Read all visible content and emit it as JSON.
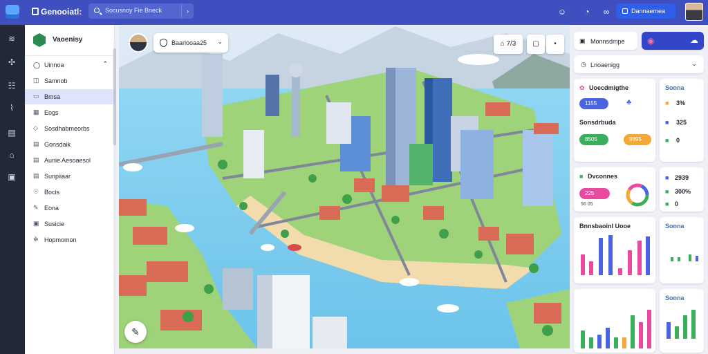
{
  "topbar": {
    "title": "Genooiatl:",
    "search_placeholder": "Socusnoy Fie Bneck",
    "user_button": "Dannaemea",
    "icons": [
      "smile-icon",
      "pie-icon",
      "link-icon"
    ]
  },
  "sidebar": {
    "title": "Vaoenisy",
    "section": "Uinnoa",
    "items": [
      {
        "label": "Samnob",
        "icon": "map-icon"
      },
      {
        "label": "Bmsa",
        "icon": "layers-icon"
      },
      {
        "label": "Eogs",
        "icon": "grid-icon"
      },
      {
        "label": "Sosdhabmeorbs",
        "icon": "tag-icon"
      },
      {
        "label": "Gonsdaik",
        "icon": "doc-icon"
      },
      {
        "label": "Aunie Aesoaesol",
        "icon": "doc-icon"
      },
      {
        "label": "Sunpiiaar",
        "icon": "doc-icon"
      },
      {
        "label": "Bocis",
        "icon": "settings-icon"
      },
      {
        "label": "Eona",
        "icon": "pencil-icon"
      },
      {
        "label": "Susicie",
        "icon": "box-icon"
      },
      {
        "label": "Hopmomon",
        "icon": "gear-icon"
      }
    ]
  },
  "map": {
    "location_select": "Baarlooaa25",
    "ctrl_layers": "7/3"
  },
  "right": {
    "top_card_label": "Monnsdmpe",
    "filter_label": "Lnoaenigg",
    "card1_title": "Uoecdmigthe",
    "card1_pill": "1155",
    "card1_stat_a": "Sonsdrbuda",
    "card1_pill_green": "8505",
    "card1_pill_orange": "9895",
    "card2_title": "Dvconnes",
    "card2_pill": "225",
    "card2_sub": "56 05",
    "side_1_title": "Sonna",
    "side_1_v1": "3%",
    "side_1_v2": "325",
    "side_1_v3": "0",
    "side_2_v1": "2939",
    "side_2_v2": "300%",
    "side_2_v3": "0",
    "chart_title": "Bnnsbaoinl Uooe",
    "side_chart_title": "Sonna",
    "side_chart2_title": "Sonna"
  }
}
